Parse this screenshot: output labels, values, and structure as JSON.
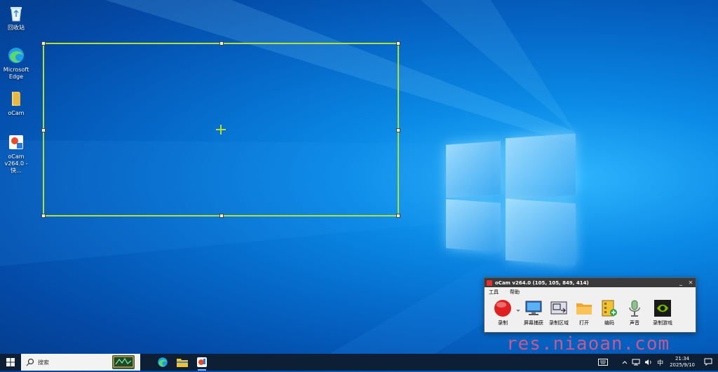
{
  "desktop": {
    "icons": [
      {
        "label": "回收站",
        "icon": "recycle-bin-icon"
      },
      {
        "label": "Microsoft Edge",
        "icon": "edge-icon"
      },
      {
        "label": "oCam",
        "icon": "folder-icon"
      },
      {
        "label": "oCam v264.0 - 快...",
        "icon": "ocam-installer-icon"
      }
    ]
  },
  "ocam": {
    "title": "oCam v264.0 (105, 105, 849, 414)",
    "window_controls": {
      "minimize": "_",
      "close": "✕"
    },
    "menu": [
      "工具",
      "帮助"
    ],
    "toolbar": [
      {
        "label": "录制",
        "icon": "record-icon"
      },
      {
        "label": "屏幕捕获",
        "icon": "screen-capture-icon"
      },
      {
        "label": "录制区域",
        "icon": "record-area-icon"
      },
      {
        "label": "打开",
        "icon": "open-folder-icon"
      },
      {
        "label": "编码",
        "icon": "codec-icon"
      },
      {
        "label": "声音",
        "icon": "microphone-icon"
      },
      {
        "label": "录制游戏",
        "icon": "game-record-icon"
      }
    ]
  },
  "taskbar": {
    "search_placeholder": "搜索",
    "apps": [
      "edge-icon",
      "file-explorer-icon",
      "ocam-icon"
    ],
    "ime": "中",
    "time": "21:34",
    "date": "2025/9/10"
  },
  "watermark": "res.niaoan.com",
  "colors": {
    "selection": "#b8e02a",
    "titlebar": "#3a3a3a",
    "taskbar": "#0d1f35"
  }
}
